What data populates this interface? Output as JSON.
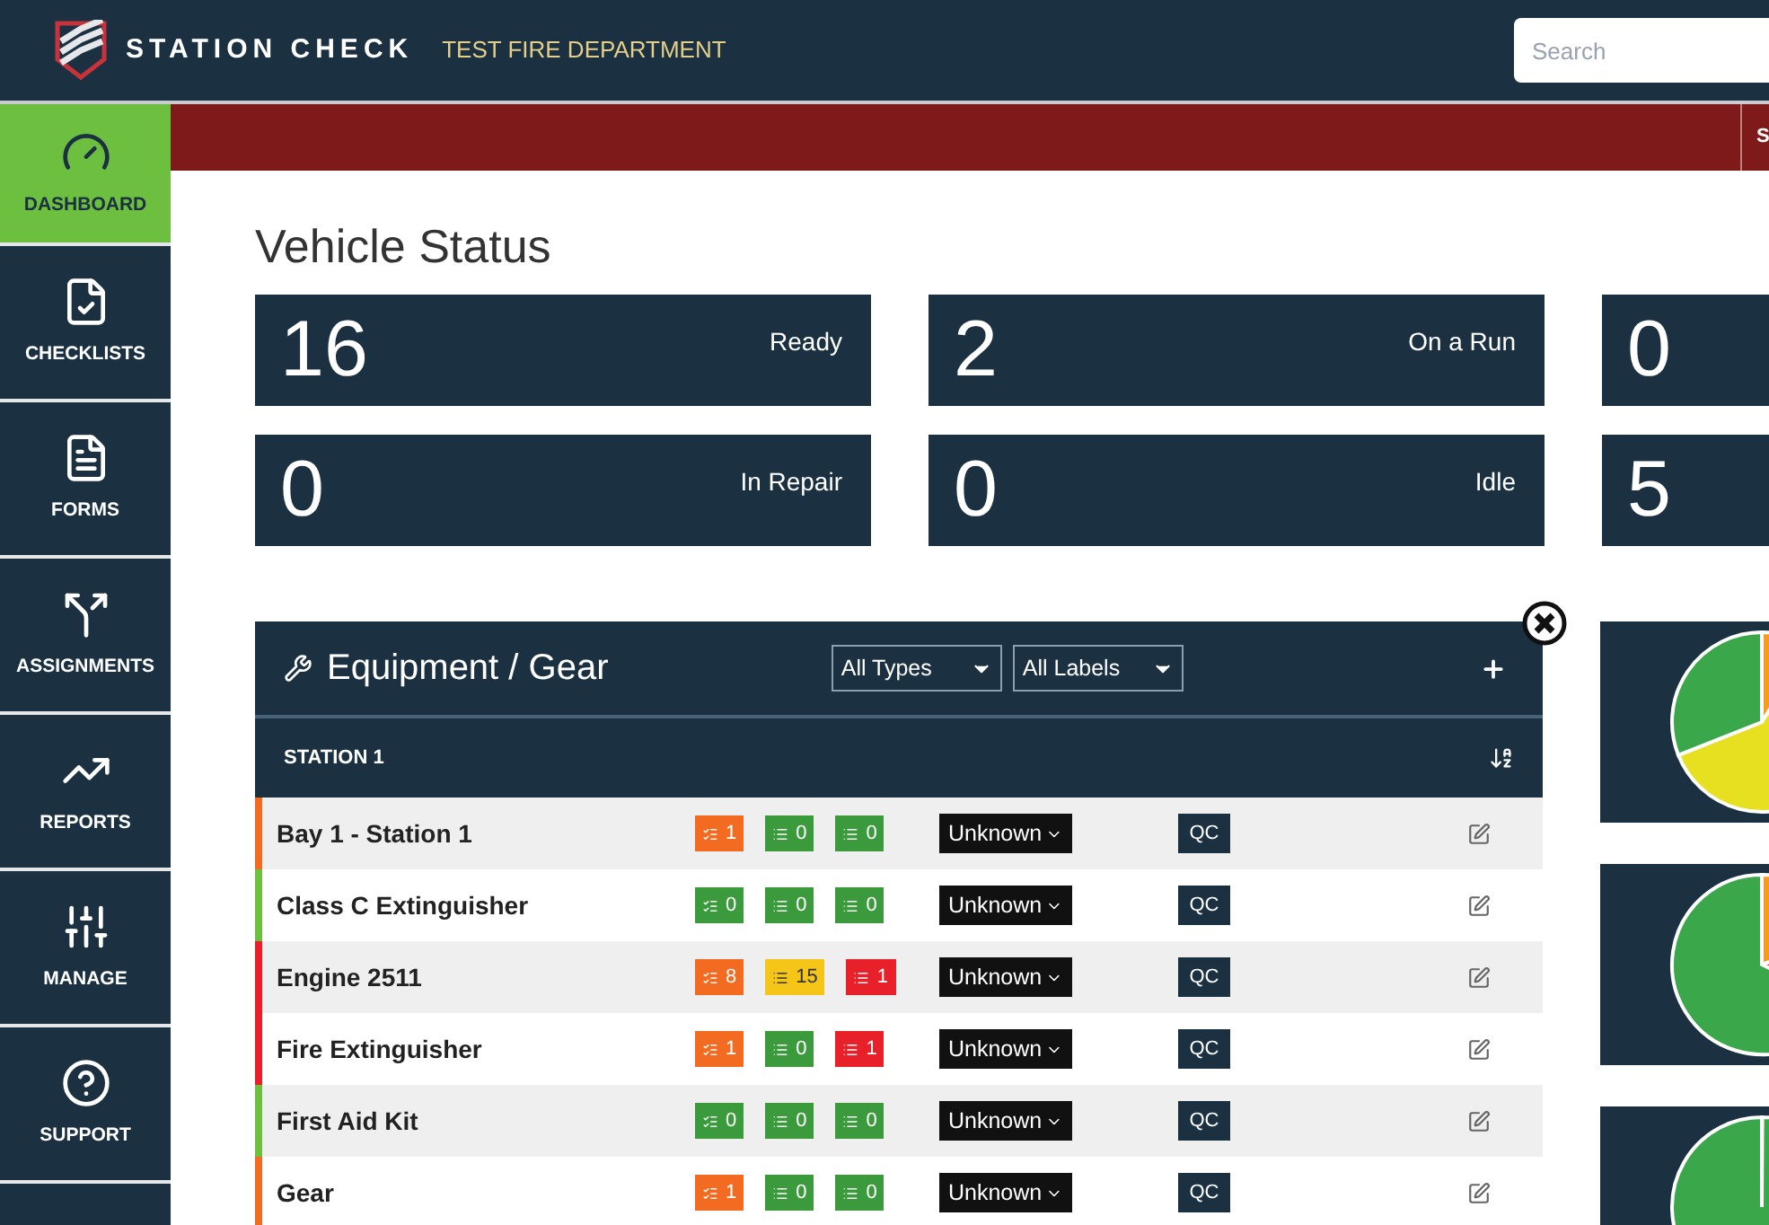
{
  "header": {
    "brand": "STATION CHECK",
    "department": "TEST FIRE DEPARTMENT",
    "search": {
      "placeholder": "Search"
    }
  },
  "alert_bar": {
    "text": "S"
  },
  "sidebar": {
    "items": [
      {
        "label": "DASHBOARD",
        "selected": true
      },
      {
        "label": "CHECKLISTS",
        "selected": false
      },
      {
        "label": "FORMS",
        "selected": false
      },
      {
        "label": "ASSIGNMENTS",
        "selected": false
      },
      {
        "label": "REPORTS",
        "selected": false
      },
      {
        "label": "MANAGE",
        "selected": false
      },
      {
        "label": "SUPPORT",
        "selected": false
      }
    ]
  },
  "page_title": "Vehicle Status",
  "stats": [
    {
      "count": "16",
      "status": "Ready"
    },
    {
      "count": "2",
      "status": "On a Run"
    },
    {
      "count": "0"
    },
    {
      "count": "0",
      "status": "In Repair"
    },
    {
      "count": "0",
      "status": "Idle"
    },
    {
      "count": "5"
    }
  ],
  "panel": {
    "title": "Equipment / Gear",
    "filters": [
      {
        "label": "All Types"
      },
      {
        "label": "All Labels"
      }
    ],
    "group": "STATION 1",
    "rows": [
      {
        "name": "Bay 1 - Station 1",
        "color": "#f26b21",
        "badges": [
          {
            "kind": "checklist",
            "color": "#f26b21",
            "count": "1"
          },
          {
            "kind": "list",
            "color": "#3a9a3c",
            "count": "0"
          },
          {
            "kind": "list",
            "color": "#3a9a3c",
            "count": "0"
          }
        ],
        "status": "Unknown",
        "action": "QC"
      },
      {
        "name": "Class C Extinguisher",
        "color": "#6cbf3f",
        "badges": [
          {
            "kind": "checklist",
            "color": "#3a9a3c",
            "count": "0"
          },
          {
            "kind": "list",
            "color": "#3a9a3c",
            "count": "0"
          },
          {
            "kind": "list",
            "color": "#3a9a3c",
            "count": "0"
          }
        ],
        "status": "Unknown",
        "action": "QC"
      },
      {
        "name": "Engine 2511",
        "color": "#e8202a",
        "badges": [
          {
            "kind": "checklist",
            "color": "#f26b21",
            "count": "8"
          },
          {
            "kind": "list",
            "color": "#f5c518",
            "count": "15"
          },
          {
            "kind": "list",
            "color": "#e8202a",
            "count": "1"
          }
        ],
        "status": "Unknown",
        "action": "QC"
      },
      {
        "name": "Fire Extinguisher",
        "color": "#e8202a",
        "badges": [
          {
            "kind": "checklist",
            "color": "#f26b21",
            "count": "1"
          },
          {
            "kind": "list",
            "color": "#3a9a3c",
            "count": "0"
          },
          {
            "kind": "list",
            "color": "#e8202a",
            "count": "1"
          }
        ],
        "status": "Unknown",
        "action": "QC"
      },
      {
        "name": "First Aid Kit",
        "color": "#6cbf3f",
        "badges": [
          {
            "kind": "checklist",
            "color": "#3a9a3c",
            "count": "0"
          },
          {
            "kind": "list",
            "color": "#3a9a3c",
            "count": "0"
          },
          {
            "kind": "list",
            "color": "#3a9a3c",
            "count": "0"
          }
        ],
        "status": "Unknown",
        "action": "QC"
      },
      {
        "name": "Gear",
        "color": "#f26b21",
        "badges": [
          {
            "kind": "checklist",
            "color": "#f26b21",
            "count": "1"
          },
          {
            "kind": "list",
            "color": "#3a9a3c",
            "count": "0"
          },
          {
            "kind": "list",
            "color": "#3a9a3c",
            "count": "0"
          }
        ],
        "status": "Unknown",
        "action": "QC"
      }
    ]
  }
}
